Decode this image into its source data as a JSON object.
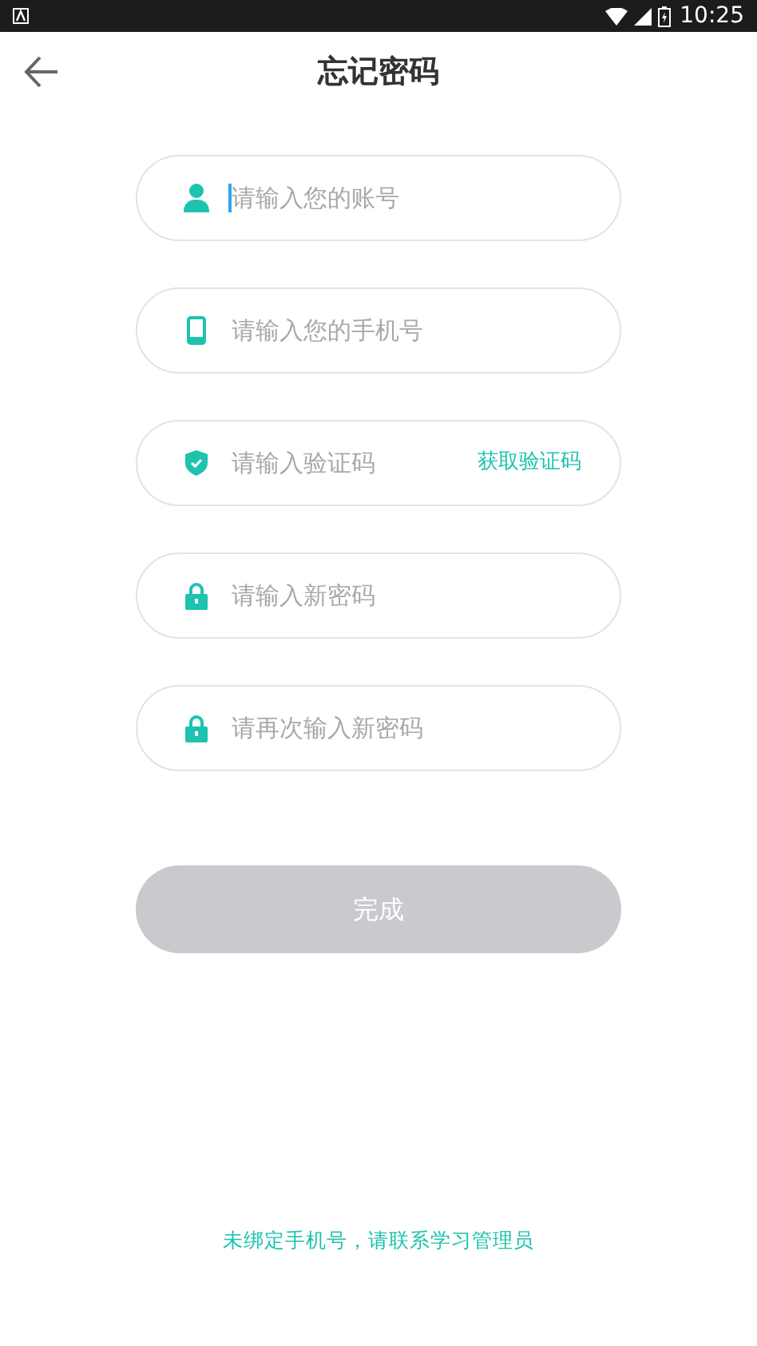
{
  "status_bar": {
    "time": "10:25"
  },
  "header": {
    "title": "忘记密码"
  },
  "fields": [
    {
      "kind": "user",
      "placeholder": "请输入您的账号",
      "focused": true
    },
    {
      "kind": "phone",
      "placeholder": "请输入您的手机号",
      "focused": false
    },
    {
      "kind": "shield",
      "placeholder": "请输入验证码",
      "focused": false,
      "action": "获取验证码"
    },
    {
      "kind": "lock",
      "placeholder": "请输入新密码",
      "focused": false
    },
    {
      "kind": "lock",
      "placeholder": "请再次输入新密码",
      "focused": false
    }
  ],
  "submit": {
    "label": "完成",
    "disabled": true
  },
  "footer": "未绑定手机号，请联系学习管理员"
}
